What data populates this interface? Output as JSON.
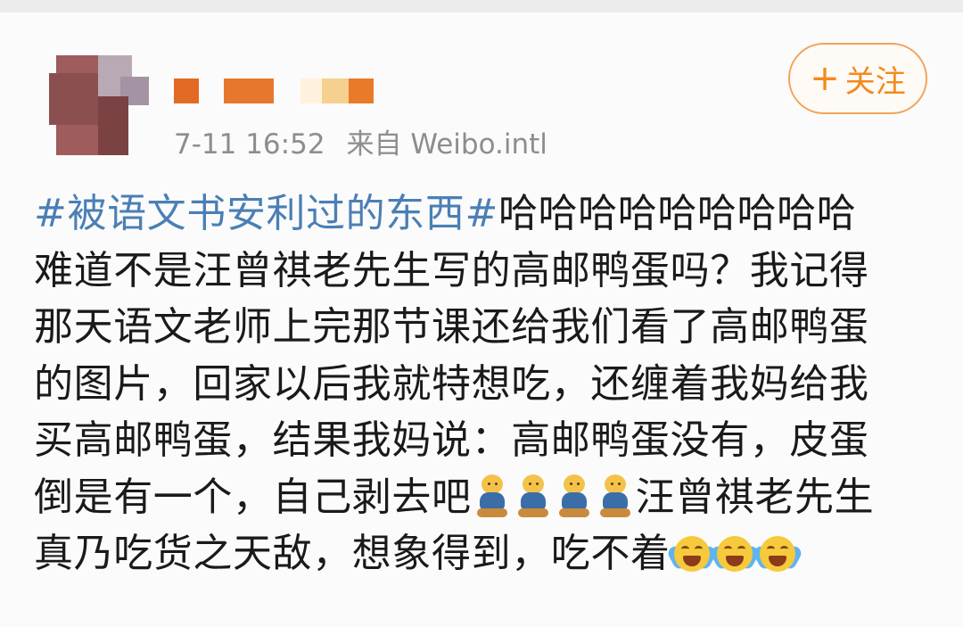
{
  "colors": {
    "hashtag": "#4a7fb5",
    "accent": "#f28a1c",
    "meta_text": "#8d8d8d"
  },
  "follow_button": {
    "icon": "plus-icon",
    "label": "关注"
  },
  "post_meta": {
    "timestamp": "7-11 16:52",
    "source": "来自 Weibo.intl"
  },
  "post": {
    "hashtag": "#被语文书安利过的东西#",
    "line1_rest": "哈哈哈哈哈哈哈哈哈",
    "line2": "难道不是汪曾祺老先生写的高邮鸭蛋吗？我记得",
    "line3": "那天语文老师上完那节课还给我们看了高邮鸭蛋",
    "line4": "的图片，回家以后我就特想吃，还缠着我妈给我",
    "line5": "买高邮鸭蛋，结果我妈说：高邮鸭蛋没有，皮蛋",
    "line6_a": "倒是有一个，自己剥去吧",
    "line6_b": "汪曾祺老先生",
    "line7": "真乃吃货之天敌，想象得到，吃不着",
    "emoji_row1": [
      "doge-bear-emoji",
      "doge-bear-emoji",
      "doge-bear-emoji",
      "doge-bear-emoji"
    ],
    "emoji_row2": [
      "laugh-cry-emoji",
      "laugh-cry-emoji",
      "laugh-cry-emoji"
    ]
  }
}
